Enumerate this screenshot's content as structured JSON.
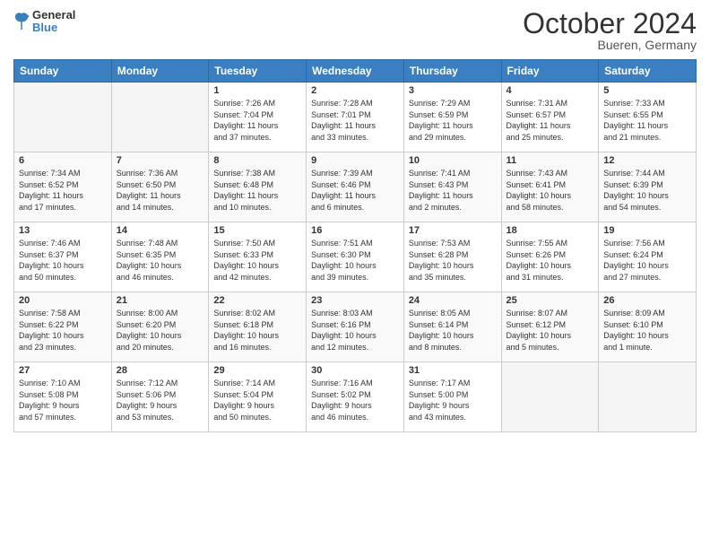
{
  "header": {
    "logo_general": "General",
    "logo_blue": "Blue",
    "month_title": "October 2024",
    "location": "Bueren, Germany"
  },
  "weekdays": [
    "Sunday",
    "Monday",
    "Tuesday",
    "Wednesday",
    "Thursday",
    "Friday",
    "Saturday"
  ],
  "weeks": [
    [
      {
        "day": "",
        "info": ""
      },
      {
        "day": "",
        "info": ""
      },
      {
        "day": "1",
        "info": "Sunrise: 7:26 AM\nSunset: 7:04 PM\nDaylight: 11 hours\nand 37 minutes."
      },
      {
        "day": "2",
        "info": "Sunrise: 7:28 AM\nSunset: 7:01 PM\nDaylight: 11 hours\nand 33 minutes."
      },
      {
        "day": "3",
        "info": "Sunrise: 7:29 AM\nSunset: 6:59 PM\nDaylight: 11 hours\nand 29 minutes."
      },
      {
        "day": "4",
        "info": "Sunrise: 7:31 AM\nSunset: 6:57 PM\nDaylight: 11 hours\nand 25 minutes."
      },
      {
        "day": "5",
        "info": "Sunrise: 7:33 AM\nSunset: 6:55 PM\nDaylight: 11 hours\nand 21 minutes."
      }
    ],
    [
      {
        "day": "6",
        "info": "Sunrise: 7:34 AM\nSunset: 6:52 PM\nDaylight: 11 hours\nand 17 minutes."
      },
      {
        "day": "7",
        "info": "Sunrise: 7:36 AM\nSunset: 6:50 PM\nDaylight: 11 hours\nand 14 minutes."
      },
      {
        "day": "8",
        "info": "Sunrise: 7:38 AM\nSunset: 6:48 PM\nDaylight: 11 hours\nand 10 minutes."
      },
      {
        "day": "9",
        "info": "Sunrise: 7:39 AM\nSunset: 6:46 PM\nDaylight: 11 hours\nand 6 minutes."
      },
      {
        "day": "10",
        "info": "Sunrise: 7:41 AM\nSunset: 6:43 PM\nDaylight: 11 hours\nand 2 minutes."
      },
      {
        "day": "11",
        "info": "Sunrise: 7:43 AM\nSunset: 6:41 PM\nDaylight: 10 hours\nand 58 minutes."
      },
      {
        "day": "12",
        "info": "Sunrise: 7:44 AM\nSunset: 6:39 PM\nDaylight: 10 hours\nand 54 minutes."
      }
    ],
    [
      {
        "day": "13",
        "info": "Sunrise: 7:46 AM\nSunset: 6:37 PM\nDaylight: 10 hours\nand 50 minutes."
      },
      {
        "day": "14",
        "info": "Sunrise: 7:48 AM\nSunset: 6:35 PM\nDaylight: 10 hours\nand 46 minutes."
      },
      {
        "day": "15",
        "info": "Sunrise: 7:50 AM\nSunset: 6:33 PM\nDaylight: 10 hours\nand 42 minutes."
      },
      {
        "day": "16",
        "info": "Sunrise: 7:51 AM\nSunset: 6:30 PM\nDaylight: 10 hours\nand 39 minutes."
      },
      {
        "day": "17",
        "info": "Sunrise: 7:53 AM\nSunset: 6:28 PM\nDaylight: 10 hours\nand 35 minutes."
      },
      {
        "day": "18",
        "info": "Sunrise: 7:55 AM\nSunset: 6:26 PM\nDaylight: 10 hours\nand 31 minutes."
      },
      {
        "day": "19",
        "info": "Sunrise: 7:56 AM\nSunset: 6:24 PM\nDaylight: 10 hours\nand 27 minutes."
      }
    ],
    [
      {
        "day": "20",
        "info": "Sunrise: 7:58 AM\nSunset: 6:22 PM\nDaylight: 10 hours\nand 23 minutes."
      },
      {
        "day": "21",
        "info": "Sunrise: 8:00 AM\nSunset: 6:20 PM\nDaylight: 10 hours\nand 20 minutes."
      },
      {
        "day": "22",
        "info": "Sunrise: 8:02 AM\nSunset: 6:18 PM\nDaylight: 10 hours\nand 16 minutes."
      },
      {
        "day": "23",
        "info": "Sunrise: 8:03 AM\nSunset: 6:16 PM\nDaylight: 10 hours\nand 12 minutes."
      },
      {
        "day": "24",
        "info": "Sunrise: 8:05 AM\nSunset: 6:14 PM\nDaylight: 10 hours\nand 8 minutes."
      },
      {
        "day": "25",
        "info": "Sunrise: 8:07 AM\nSunset: 6:12 PM\nDaylight: 10 hours\nand 5 minutes."
      },
      {
        "day": "26",
        "info": "Sunrise: 8:09 AM\nSunset: 6:10 PM\nDaylight: 10 hours\nand 1 minute."
      }
    ],
    [
      {
        "day": "27",
        "info": "Sunrise: 7:10 AM\nSunset: 5:08 PM\nDaylight: 9 hours\nand 57 minutes."
      },
      {
        "day": "28",
        "info": "Sunrise: 7:12 AM\nSunset: 5:06 PM\nDaylight: 9 hours\nand 53 minutes."
      },
      {
        "day": "29",
        "info": "Sunrise: 7:14 AM\nSunset: 5:04 PM\nDaylight: 9 hours\nand 50 minutes."
      },
      {
        "day": "30",
        "info": "Sunrise: 7:16 AM\nSunset: 5:02 PM\nDaylight: 9 hours\nand 46 minutes."
      },
      {
        "day": "31",
        "info": "Sunrise: 7:17 AM\nSunset: 5:00 PM\nDaylight: 9 hours\nand 43 minutes."
      },
      {
        "day": "",
        "info": ""
      },
      {
        "day": "",
        "info": ""
      }
    ]
  ]
}
